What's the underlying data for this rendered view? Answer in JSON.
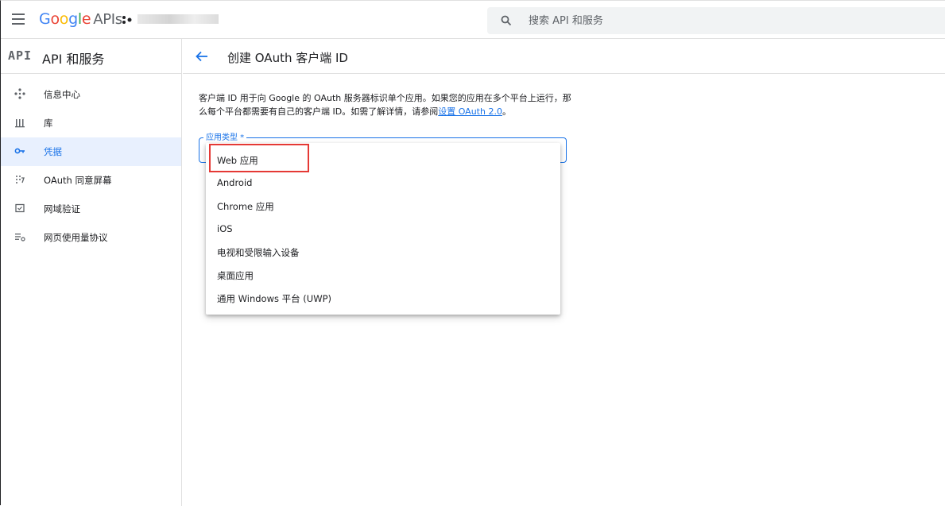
{
  "header": {
    "logo_text": "Google APIs",
    "search_placeholder": "搜索 API 和服务"
  },
  "sidebar": {
    "mark": "API",
    "title": "API 和服务",
    "items": [
      {
        "label": "信息中心",
        "icon": "dashboard-icon",
        "active": false
      },
      {
        "label": "库",
        "icon": "library-icon",
        "active": false
      },
      {
        "label": "凭据",
        "icon": "key-icon",
        "active": true
      },
      {
        "label": "OAuth 同意屏幕",
        "icon": "consent-screen-icon",
        "active": false
      },
      {
        "label": "网域验证",
        "icon": "domain-verification-icon",
        "active": false
      },
      {
        "label": "网页使用量协议",
        "icon": "page-usage-agreement-icon",
        "active": false
      }
    ]
  },
  "main": {
    "title": "创建 OAuth 客户端 ID",
    "description": "客户端 ID 用于向 Google 的 OAuth 服务器标识单个应用。如果您的应用在多个平台上运行，那么每个平台都需要有自己的客户端 ID。如需了解详情，请参阅",
    "description_link": "设置 OAuth 2.0",
    "description_end": "。",
    "field_label": "应用类型 *",
    "options": [
      "Web 应用",
      "Android",
      "Chrome 应用",
      "iOS",
      "电视和受限输入设备",
      "桌面应用",
      "通用 Windows 平台 (UWP)"
    ]
  },
  "colors": {
    "accent": "#1a73e8",
    "highlight_box": "#e53935",
    "active_nav_bg": "#e8f0fe"
  }
}
